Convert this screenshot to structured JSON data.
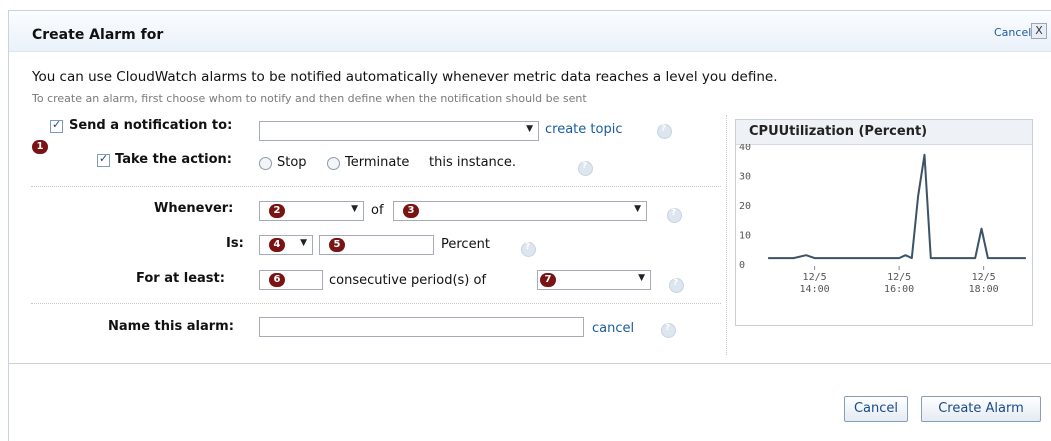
{
  "dialog": {
    "title": "Create Alarm for",
    "cancel_link": "Cancel",
    "close_glyph": "X",
    "intro": "You can use CloudWatch alarms to be notified automatically whenever metric data reaches a level you define.",
    "subtext": "To create an alarm, first choose whom to notify and then define when the notification should be sent"
  },
  "notify": {
    "label": "Send a notification to:",
    "checked": true,
    "selected": "",
    "create_topic": "create topic",
    "badge": "1"
  },
  "action": {
    "label": "Take the action:",
    "checked": true,
    "stop": "Stop",
    "terminate": "Terminate",
    "suffix": "this instance."
  },
  "whenever": {
    "label": "Whenever:",
    "of": "of",
    "badge_a": "2",
    "badge_b": "3"
  },
  "is": {
    "label": "Is:",
    "unit": "Percent",
    "badge_a": "4",
    "badge_b": "5"
  },
  "atleast": {
    "label": "For at least:",
    "middle": "consecutive period(s) of",
    "badge_a": "6",
    "badge_b": "7"
  },
  "name": {
    "label": "Name this alarm:",
    "value": "",
    "cancel": "cancel"
  },
  "buttons": {
    "cancel": "Cancel",
    "create": "Create Alarm"
  },
  "icons": {
    "help": "help-icon",
    "dropdown": "chevron-down-icon"
  },
  "colors": {
    "badge": "#7a1313",
    "link": "#1a5c9e",
    "line": "#3c5266"
  },
  "chart_data": {
    "type": "line",
    "title": "CPUUtilization (Percent)",
    "ylim": [
      0,
      40
    ],
    "yticks": [
      "40",
      "30",
      "20",
      "10",
      "0"
    ],
    "xticks": [
      [
        "12/5",
        "14:00"
      ],
      [
        "12/5",
        "16:00"
      ],
      [
        "12/5",
        "18:00"
      ]
    ],
    "x_hours": [
      12.9,
      13.2,
      13.5,
      13.8,
      14.0,
      14.2,
      14.5,
      14.8,
      15.0,
      15.2,
      15.4,
      15.6,
      15.75,
      15.85,
      16.0,
      16.15,
      16.3,
      16.45,
      16.6,
      16.75,
      16.9,
      17.0,
      17.2,
      17.4,
      17.6,
      17.8,
      17.95,
      18.1,
      18.25,
      18.4,
      18.6,
      18.8,
      19.0
    ],
    "values": [
      2,
      2,
      2,
      3,
      2,
      2,
      2,
      2,
      2,
      2,
      2,
      2,
      2,
      2,
      2,
      3,
      2,
      23,
      37,
      2,
      2,
      2,
      2,
      2,
      2,
      2,
      12,
      2,
      2,
      2,
      2,
      2,
      2
    ],
    "grid": false
  }
}
